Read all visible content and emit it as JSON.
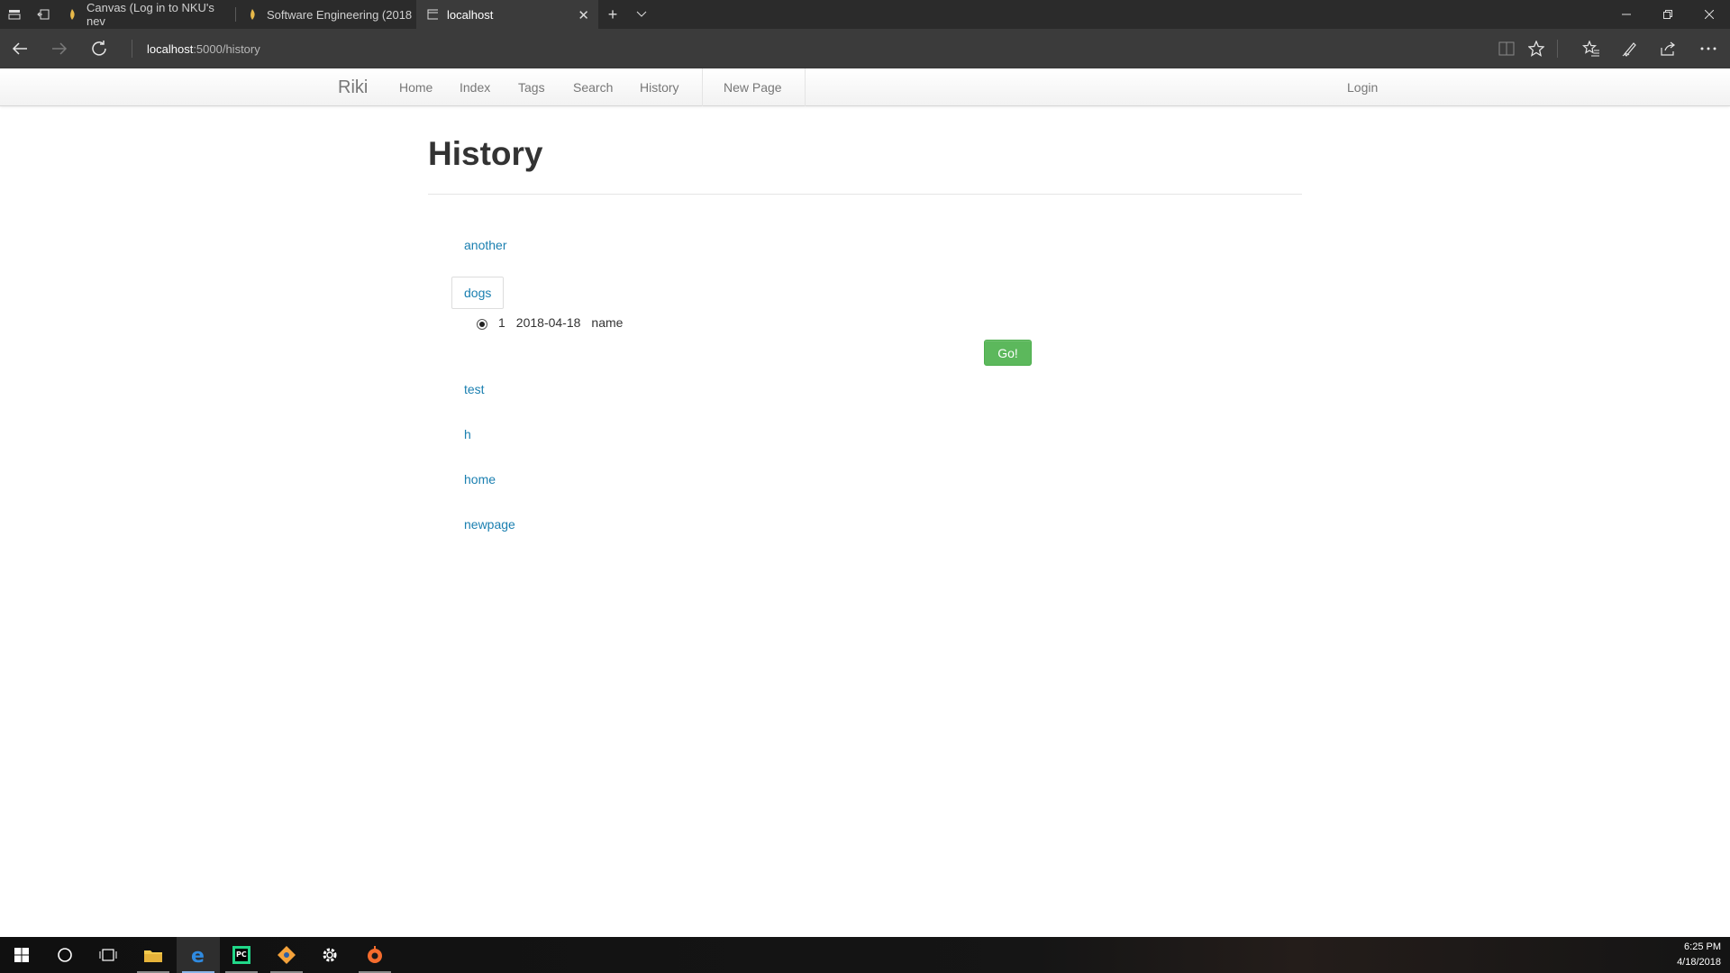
{
  "browser": {
    "tabs": [
      {
        "title": "Canvas (Log in to NKU's nev",
        "active": false
      },
      {
        "title": "Software Engineering (2018",
        "active": false
      },
      {
        "title": "localhost",
        "active": true
      }
    ],
    "address": {
      "host": "localhost",
      "path": ":5000/history"
    }
  },
  "site": {
    "brand": "Riki",
    "nav": [
      "Home",
      "Index",
      "Tags",
      "Search",
      "History",
      "New Page"
    ],
    "login": "Login"
  },
  "page": {
    "title": "History",
    "pages": [
      "another",
      "dogs",
      "test",
      "h",
      "home",
      "newpage"
    ],
    "expanded": {
      "revision": {
        "number": "1",
        "date": "2018-04-18",
        "author": "name",
        "selected": true
      },
      "go_label": "Go!"
    }
  },
  "taskbar": {
    "time": "6:25 PM",
    "date": "4/18/2018"
  },
  "colors": {
    "link": "#1a7fb0",
    "go_button": "#5cb85c",
    "chrome_dark": "#2b2b2b"
  }
}
